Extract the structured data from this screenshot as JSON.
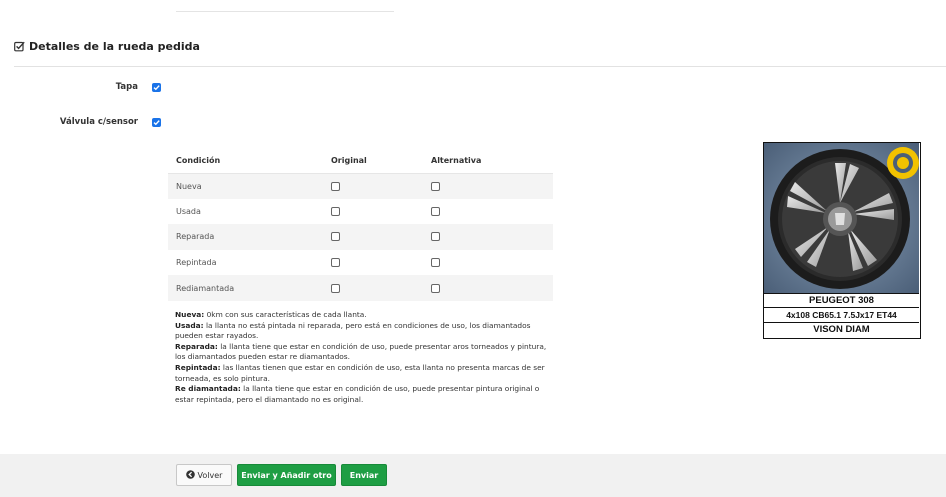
{
  "section": {
    "title": "Detalles de la rueda pedida",
    "icon": "check-square-icon"
  },
  "fields": [
    {
      "label": "Tapa",
      "checked": true
    },
    {
      "label": "Válvula c/sensor",
      "checked": true
    }
  ],
  "condition_table": {
    "headers": [
      "Condición",
      "Original",
      "Alternativa"
    ],
    "rows": [
      {
        "label": "Nueva",
        "original": false,
        "alternativa": false
      },
      {
        "label": "Usada",
        "original": false,
        "alternativa": false
      },
      {
        "label": "Reparada",
        "original": false,
        "alternativa": false
      },
      {
        "label": "Repintada",
        "original": false,
        "alternativa": false
      },
      {
        "label": "Rediamantada",
        "original": false,
        "alternativa": false
      }
    ]
  },
  "legend": [
    {
      "term": "Nueva:",
      "text": " 0km con sus características de cada llanta."
    },
    {
      "term": "Usada:",
      "text": " la llanta no está pintada ni reparada, pero está en condiciones de uso, los diamantados pueden estar rayados."
    },
    {
      "term": "Reparada:",
      "text": " la llanta tiene que estar en condición de uso, puede presentar aros torneados y pintura, los diamantados pueden estar re diamantados."
    },
    {
      "term": "Repintada:",
      "text": " las llantas tienen que estar en condición de uso, esta llanta no presenta marcas de ser torneada, es solo pintura."
    },
    {
      "term": "Re diamantada:",
      "text": " la llanta tiene que estar en condición de uso, puede presentar pintura original o estar repintada, pero el diamantado no es original."
    }
  ],
  "product": {
    "model": "PEUGEOT 308",
    "spec": "4x108 CB65.1 7.5Jx17 ET44",
    "finish": "VISON DIAM"
  },
  "buttons": {
    "back": "Volver",
    "save_add": "Enviar y Añadir otro",
    "send": "Enviar"
  },
  "colors": {
    "primary_green": "#1e9e44",
    "checkbox_blue": "#1a73e8"
  }
}
